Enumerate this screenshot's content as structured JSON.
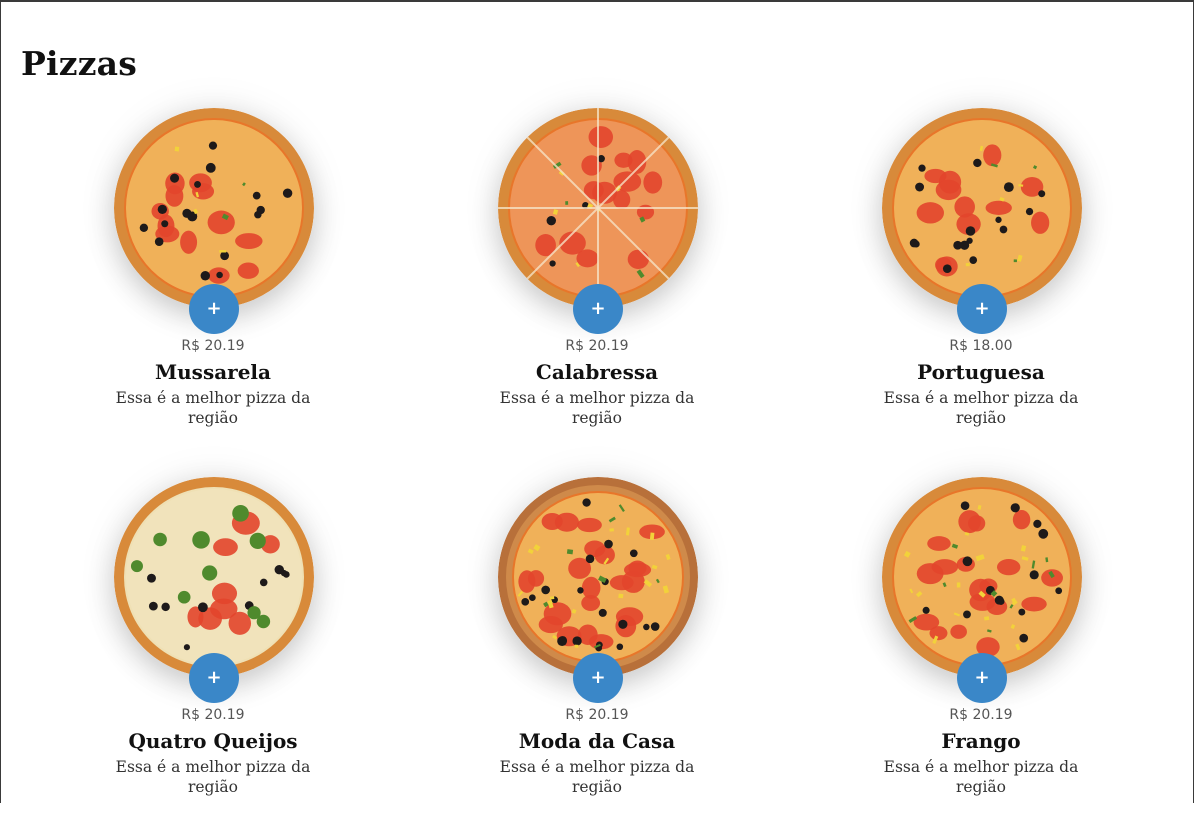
{
  "page": {
    "title": "Pizzas"
  },
  "pizzas": [
    {
      "name": "Mussarela",
      "price": "R$ 20.19",
      "description": "Essa é a melhor pizza da região",
      "add_label": "+",
      "style": "tomato"
    },
    {
      "name": "Calabressa",
      "price": "R$ 20.19",
      "description": "Essa é a melhor pizza da região",
      "add_label": "+",
      "style": "sliced"
    },
    {
      "name": "Portuguesa",
      "price": "R$ 18.00",
      "description": "Essa é a melhor pizza da região",
      "add_label": "+",
      "style": "olive"
    },
    {
      "name": "Quatro Queijos",
      "price": "R$ 20.19",
      "description": "Essa é a melhor pizza da região",
      "add_label": "+",
      "style": "broccoli"
    },
    {
      "name": "Moda da Casa",
      "price": "R$ 20.19",
      "description": "Essa é a melhor pizza da região",
      "add_label": "+",
      "style": "board"
    },
    {
      "name": "Frango",
      "price": "R$ 20.19",
      "description": "Essa é a melhor pizza da região",
      "add_label": "+",
      "style": "veggie"
    }
  ],
  "colors": {
    "accent": "#3a87c8",
    "crust": "#d88a3a",
    "sauce": "#e8762a",
    "cheese": "#f3c56a",
    "tomato": "#e2452c",
    "olive": "#1e1a1a",
    "green": "#4f8a2d"
  }
}
